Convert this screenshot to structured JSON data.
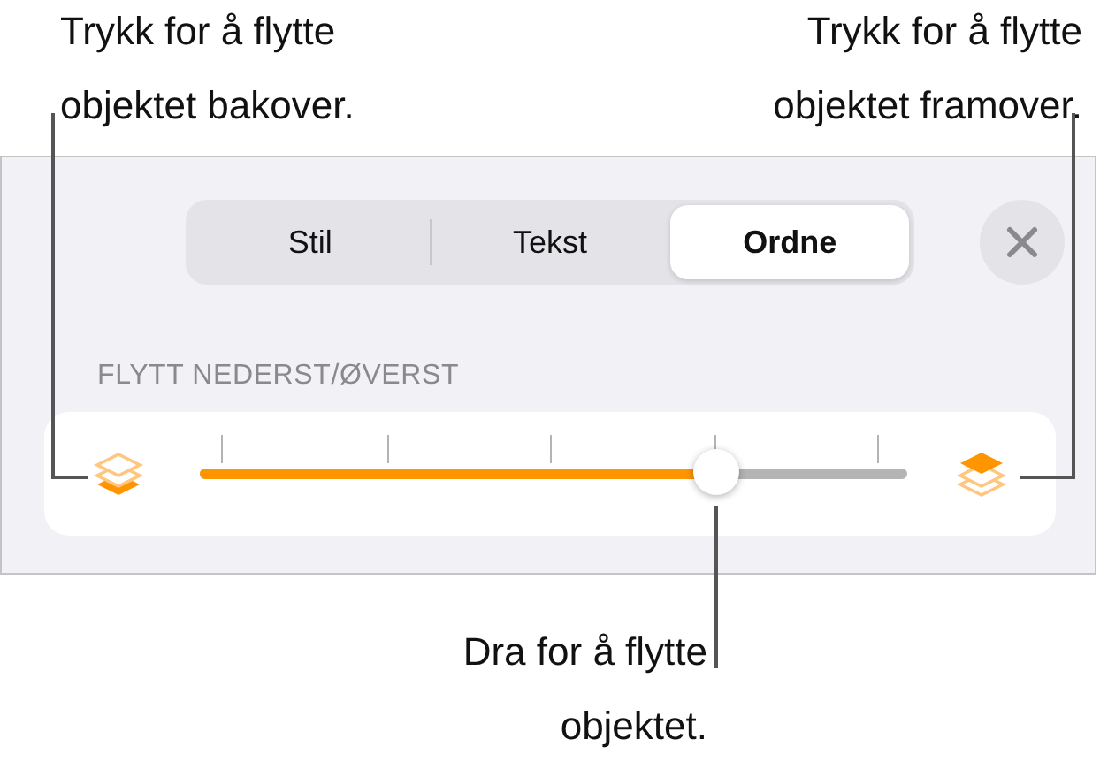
{
  "callouts": [
    {
      "text": "Trykk for å flytte\nobjektet bakover.",
      "kind": "left"
    },
    {
      "text": "Trykk for å flytte\nobjektet framover.",
      "kind": "right"
    },
    {
      "text": "Dra for å flytte\nobjektet.",
      "kind": "bottom"
    }
  ],
  "tabs": [
    {
      "label": "Stil",
      "selected": false
    },
    {
      "label": "Tekst",
      "selected": false
    },
    {
      "label": "Ordne",
      "selected": true
    }
  ],
  "section_label": "FLYTT NEDERST/ØVERST",
  "slider": {
    "level": 0.73
  }
}
